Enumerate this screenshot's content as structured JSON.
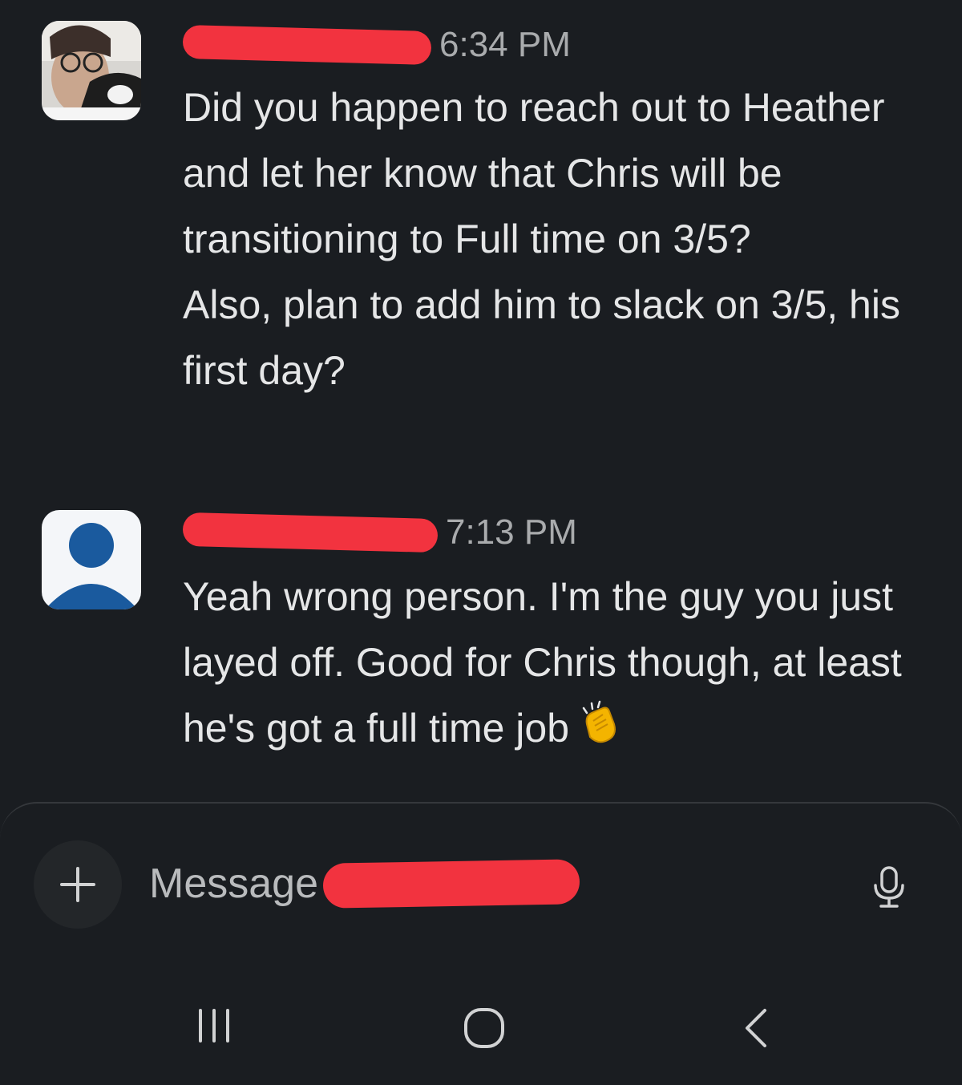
{
  "messages": [
    {
      "sender_name": "",
      "time": "6:34 PM",
      "avatar": "user-photo-avatar",
      "lines": [
        "Did you happen to reach out to Heather and let her know that Chris will be transitioning to Full time on 3/5?",
        "Also, plan to add him to slack on 3/5, his first day?"
      ]
    },
    {
      "sender_name": "",
      "time": "7:13 PM",
      "avatar": "default-person-avatar",
      "text": "Yeah wrong person. I'm the guy you just layed off. Good for Chris though, at least he's got a full time job",
      "emoji": "clapping-hands-icon"
    }
  ],
  "composer": {
    "placeholder": "Message",
    "add_icon": "plus-icon",
    "voice_icon": "microphone-icon"
  },
  "navbar": {
    "recents_icon": "recent-apps-icon",
    "home_icon": "home-icon",
    "back_icon": "back-chevron-icon"
  },
  "colors": {
    "background": "#1a1d21",
    "redaction": "#f2333f",
    "avatar_blue": "#1a5a9e"
  }
}
